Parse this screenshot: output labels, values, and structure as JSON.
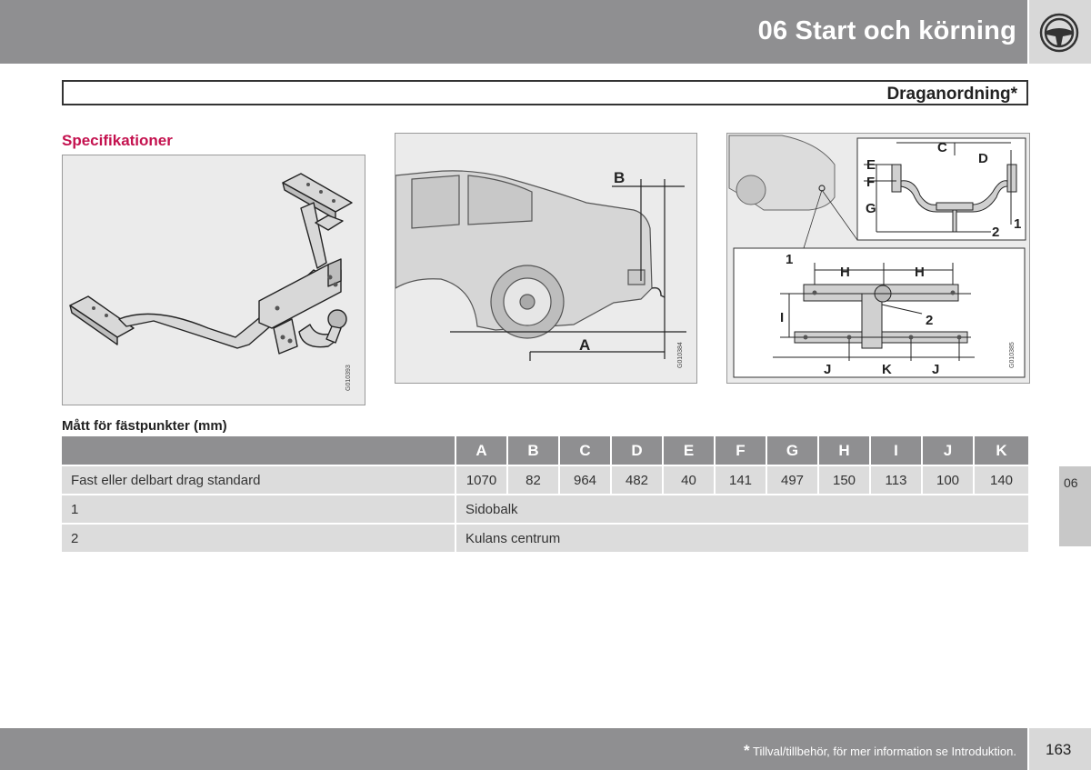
{
  "header": {
    "chapter_title": "06 Start och körning",
    "icon": "steering-wheel-icon"
  },
  "section": {
    "title": "Draganordning*"
  },
  "subheading": "Specifikationer",
  "figures": [
    {
      "code": "G010393"
    },
    {
      "code": "G010384",
      "labels": [
        "A",
        "B"
      ]
    },
    {
      "code": "G010385",
      "labels": [
        "C",
        "D",
        "E",
        "F",
        "G",
        "1",
        "2",
        "1",
        "H",
        "H",
        "I",
        "2",
        "J",
        "K",
        "J"
      ]
    }
  ],
  "table": {
    "caption": "Mått för fästpunkter (mm)",
    "headers": [
      "A",
      "B",
      "C",
      "D",
      "E",
      "F",
      "G",
      "H",
      "I",
      "J",
      "K"
    ],
    "row_standard": {
      "label": "Fast eller delbart drag standard",
      "values": [
        "1070",
        "82",
        "964",
        "482",
        "40",
        "141",
        "497",
        "150",
        "113",
        "100",
        "140"
      ]
    },
    "row_1": {
      "label": "1",
      "desc": "Sidobalk"
    },
    "row_2": {
      "label": "2",
      "desc": "Kulans centrum"
    }
  },
  "side_tab": "06",
  "footer": {
    "star": "*",
    "note": "Tillval/tillbehör, för mer information se Introduktion."
  },
  "page_number": "163"
}
